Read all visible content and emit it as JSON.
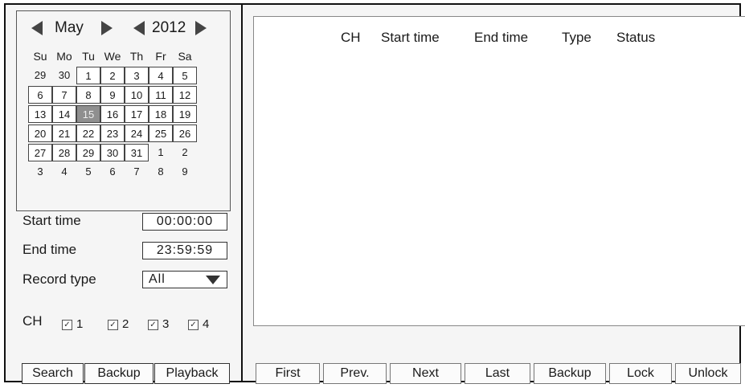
{
  "calendar": {
    "month": "May",
    "year": "2012",
    "weekdays": [
      "Su",
      "Mo",
      "Tu",
      "We",
      "Th",
      "Fr",
      "Sa"
    ],
    "weeks": [
      [
        "29",
        "30",
        "1",
        "2",
        "3",
        "4",
        "5"
      ],
      [
        "6",
        "7",
        "8",
        "9",
        "10",
        "11",
        "12"
      ],
      [
        "13",
        "14",
        "15",
        "16",
        "17",
        "18",
        "19"
      ],
      [
        "20",
        "21",
        "22",
        "23",
        "24",
        "25",
        "26"
      ],
      [
        "27",
        "28",
        "29",
        "30",
        "31",
        "1",
        "2"
      ],
      [
        "3",
        "4",
        "5",
        "6",
        "7",
        "8",
        "9"
      ]
    ],
    "selected_day": "15"
  },
  "form": {
    "start_time_label": "Start time",
    "start_time_value": "00:00:00",
    "end_time_label": "End time",
    "end_time_value": "23:59:59",
    "record_type_label": "Record type",
    "record_type_value": "All",
    "ch_label": "CH",
    "channels": [
      {
        "label": "1",
        "checked": true
      },
      {
        "label": "2",
        "checked": true
      },
      {
        "label": "3",
        "checked": true
      },
      {
        "label": "4",
        "checked": true
      }
    ]
  },
  "left_buttons": {
    "search": "Search",
    "backup": "Backup",
    "playback": "Playback"
  },
  "results": {
    "columns": [
      "CH",
      "Start time",
      "End time",
      "Type",
      "Status"
    ]
  },
  "pager": {
    "first": "First",
    "prev": "Prev.",
    "next": "Next",
    "last": "Last",
    "backup": "Backup",
    "lock": "Lock",
    "unlock": "Unlock"
  }
}
